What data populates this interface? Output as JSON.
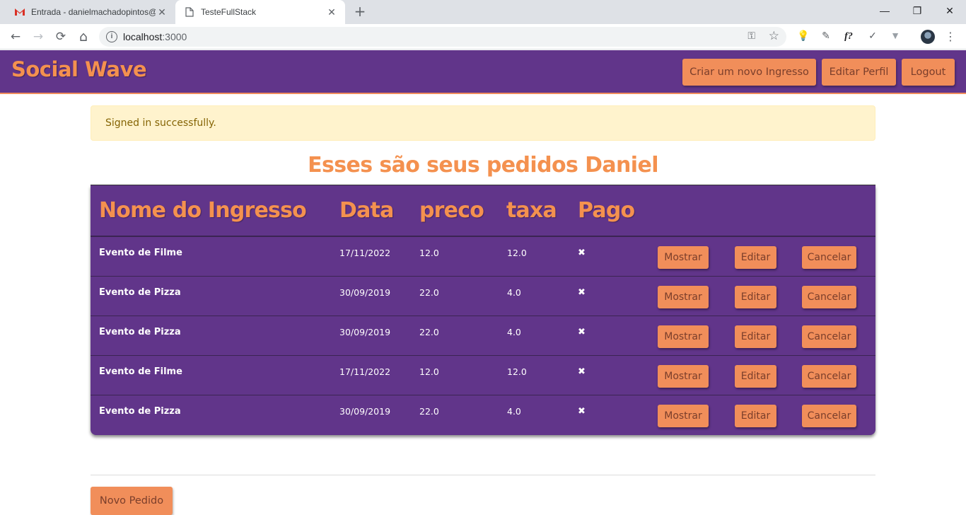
{
  "browser": {
    "tabs": [
      {
        "title": "Entrada - danielmachadopintos@",
        "icon": "gmail-icon",
        "active": false
      },
      {
        "title": "TesteFullStack",
        "icon": "page-icon",
        "active": true
      }
    ],
    "url_host": "localhost",
    "url_port": ":3000",
    "controls": {
      "back": "←",
      "forward": "→",
      "reload": "⟳",
      "home": "⌂",
      "new_tab": "+",
      "close": "✕",
      "minimize": "—",
      "restore": "❐",
      "window_close": "✕",
      "key": "⚿",
      "star": "☆",
      "menu": "⋮"
    },
    "extensions": [
      "💡",
      "✎",
      "f?",
      "✓",
      "▼"
    ]
  },
  "navbar": {
    "brand": "Social Wave",
    "buttons": [
      "Criar um novo Ingresso",
      "Editar Perfil",
      "Logout"
    ],
    "bg_color": "#61358a",
    "accent_color": "#f18e5a"
  },
  "flash": {
    "message": "Signed in successfully."
  },
  "page": {
    "heading": "Esses são seus pedidos Daniel"
  },
  "table": {
    "columns": [
      "Nome do Ingresso",
      "Data",
      "preco",
      "taxa",
      "Pago"
    ],
    "action_labels": [
      "Mostrar",
      "Editar",
      "Cancelar"
    ],
    "rows": [
      {
        "nome": "Evento de Filme",
        "data": "17/11/2022",
        "preco": "12.0",
        "taxa": "12.0",
        "pago": "✖"
      },
      {
        "nome": "Evento de Pizza",
        "data": "30/09/2019",
        "preco": "22.0",
        "taxa": "4.0",
        "pago": "✖"
      },
      {
        "nome": "Evento de Pizza",
        "data": "30/09/2019",
        "preco": "22.0",
        "taxa": "4.0",
        "pago": "✖"
      },
      {
        "nome": "Evento de Filme",
        "data": "17/11/2022",
        "preco": "12.0",
        "taxa": "12.0",
        "pago": "✖"
      },
      {
        "nome": "Evento de Pizza",
        "data": "30/09/2019",
        "preco": "22.0",
        "taxa": "4.0",
        "pago": "✖"
      }
    ]
  },
  "footer": {
    "new_order_label": "Novo Pedido"
  }
}
